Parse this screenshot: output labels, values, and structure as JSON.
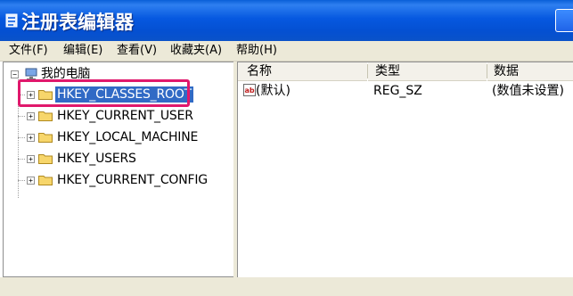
{
  "window": {
    "title": "注册表编辑器"
  },
  "menubar": {
    "items": [
      {
        "label": "文件(F)"
      },
      {
        "label": "编辑(E)"
      },
      {
        "label": "查看(V)"
      },
      {
        "label": "收藏夹(A)"
      },
      {
        "label": "帮助(H)"
      }
    ]
  },
  "tree": {
    "root": {
      "label": "我的电脑",
      "icon": "computer-icon",
      "expanded": true
    },
    "children": [
      {
        "label": "HKEY_CLASSES_ROOT",
        "selected": true,
        "icon": "folder-icon"
      },
      {
        "label": "HKEY_CURRENT_USER",
        "selected": false,
        "icon": "folder-icon"
      },
      {
        "label": "HKEY_LOCAL_MACHINE",
        "selected": false,
        "icon": "folder-icon"
      },
      {
        "label": "HKEY_USERS",
        "selected": false,
        "icon": "folder-icon"
      },
      {
        "label": "HKEY_CURRENT_CONFIG",
        "selected": false,
        "icon": "folder-icon"
      }
    ]
  },
  "values_table": {
    "columns": [
      "名称",
      "类型",
      "数据"
    ],
    "rows": [
      {
        "name": "(默认)",
        "type": "REG_SZ",
        "data": "(数值未设置)",
        "icon": "string-value-icon"
      }
    ]
  },
  "colors": {
    "titlebar": "#0658e0",
    "selection": "#316ac5",
    "annotation_frame": "#e0186c",
    "menubar": "#ece9d8"
  }
}
